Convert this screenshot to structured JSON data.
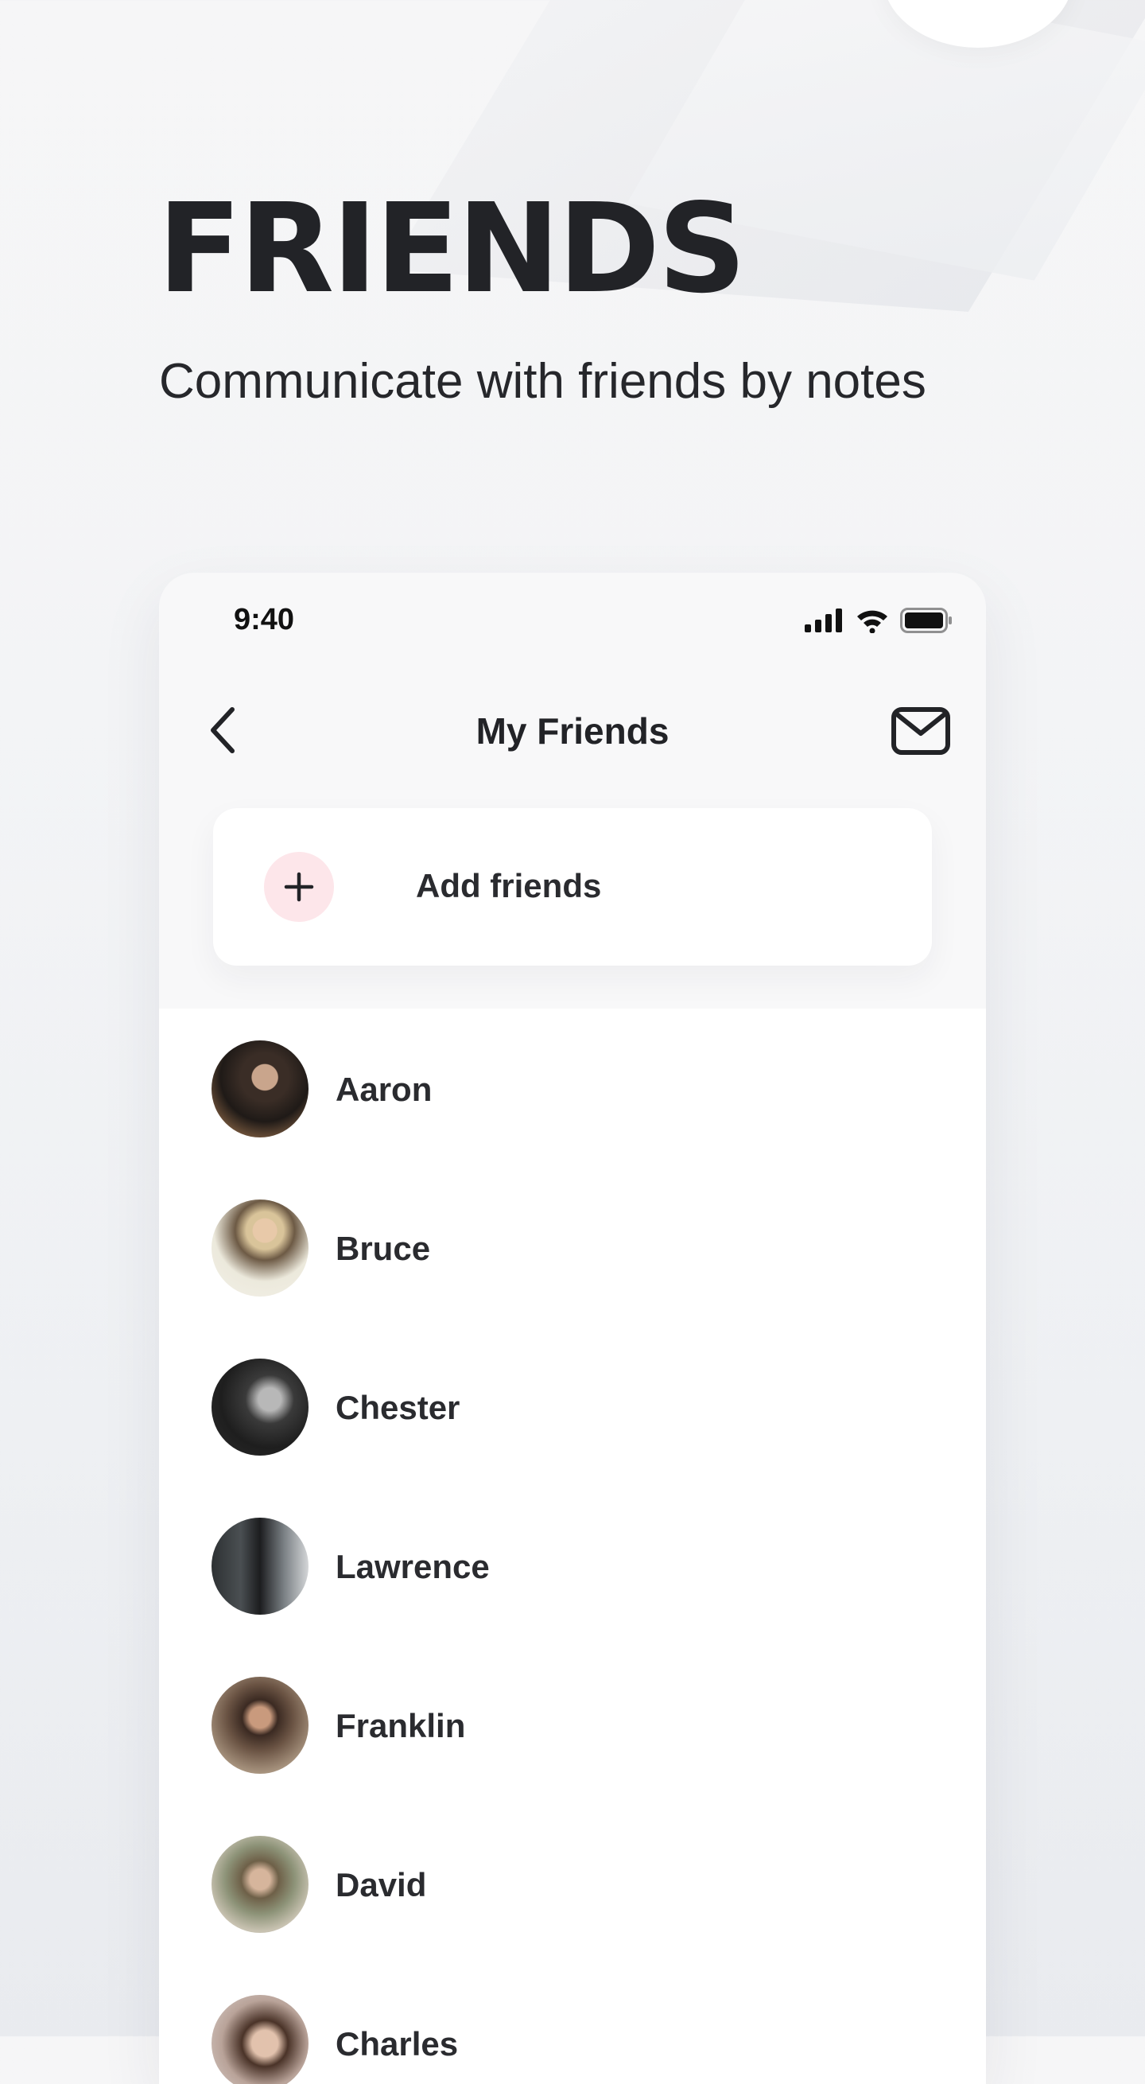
{
  "hero": {
    "title": "FRIENDS",
    "subtitle": "Communicate with friends by notes"
  },
  "status_bar": {
    "time": "9:40",
    "icons": [
      "cellular-signal-icon",
      "wifi-icon",
      "battery-icon"
    ]
  },
  "nav": {
    "title": "My Friends",
    "back_icon": "chevron-left-icon",
    "mail_icon": "envelope-icon"
  },
  "add_friends": {
    "label": "Add friends",
    "icon": "plus-icon"
  },
  "friends": [
    {
      "name": "Aaron"
    },
    {
      "name": "Bruce"
    },
    {
      "name": "Chester"
    },
    {
      "name": "Lawrence"
    },
    {
      "name": "Franklin"
    },
    {
      "name": "David"
    },
    {
      "name": "Charles"
    }
  ],
  "colors": {
    "text": "#222327",
    "accent_soft": "#fde6ea",
    "card": "#ffffff",
    "background": "#f3f4f6"
  }
}
